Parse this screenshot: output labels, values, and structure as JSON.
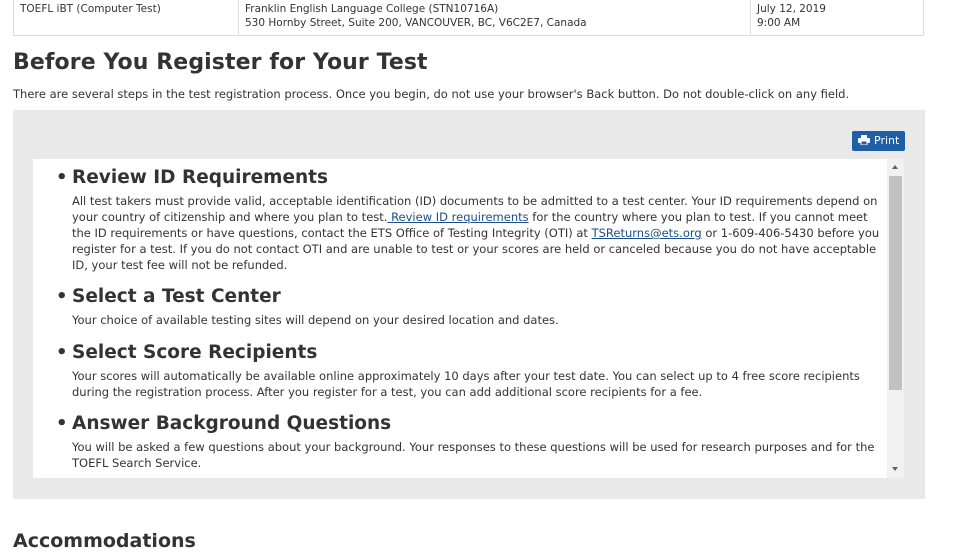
{
  "summary": {
    "test_name": "TOEFL iBT (Computer Test)",
    "center_name": "Franklin English Language College (STN10716A)",
    "center_address": "530 Hornby Street,  Suite 200,  VANCOUVER,  BC,  V6C2E7,  Canada",
    "date": "July 12, 2019",
    "time": "9:00 AM"
  },
  "page": {
    "title": "Before You Register for Your Test",
    "intro": "There are several steps in the test registration process. Once you begin, do not use your browser's Back button. Do not double-click on any field."
  },
  "print_button": {
    "label": "Print",
    "icon": "printer-icon",
    "color": "#1f5fa5"
  },
  "sections": {
    "id_req": {
      "title": "Review ID Requirements",
      "text_1": "All test takers must provide valid, acceptable identification (ID) documents to be admitted to a test center. Your ID requirements depend on your country of citizenship and where you plan to test.",
      "link_1": " Review ID requirements",
      "text_2": " for the country where you plan to test. If you cannot meet the ID requirements or have questions, contact the ETS Office of Testing Integrity (OTI) at ",
      "link_2": "TSReturns@ets.org",
      "text_3": " or 1-609-406-5430 before you register for a test. If you do not contact OTI and are unable to test or your scores are held or canceled because you do not have acceptable ID, your test fee will not be refunded."
    },
    "center": {
      "title": "Select a Test Center",
      "text": "Your choice of available testing sites will depend on your desired location and dates."
    },
    "scores": {
      "title": "Select Score Recipients",
      "text": "Your scores will automatically be available online approximately 10 days after your test date. You can select up to 4 free score recipients during the registration process. After you register for a test, you can add additional score recipients for a fee."
    },
    "background": {
      "title": "Answer Background Questions",
      "text": "You will be asked a few questions about your background. Your responses to these questions will be used for research purposes and for the TOEFL Search Service."
    }
  },
  "accommodations": {
    "title": "Accommodations"
  },
  "colors": {
    "panel_bg": "#e9e9e9",
    "link": "#1a4f8b",
    "text": "#333333"
  }
}
